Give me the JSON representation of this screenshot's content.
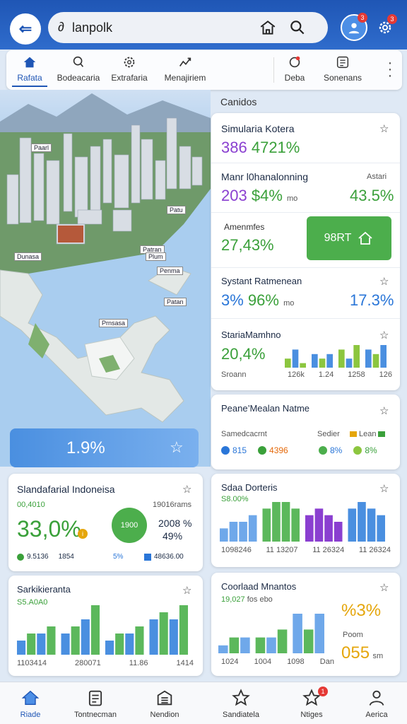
{
  "header": {
    "back_glyph": "⇐",
    "search_lead": "∂",
    "search_value": "lanpolk",
    "badge_1": "3",
    "badge_2": "3"
  },
  "tabs": [
    {
      "label": "Rafata",
      "icon": "home-icon"
    },
    {
      "label": "Bodeacaria",
      "icon": "search-icon"
    },
    {
      "label": "Extrafaria",
      "icon": "gear-icon"
    },
    {
      "label": "Menajiriem",
      "icon": "chart-icon"
    },
    {
      "label": "Deba",
      "icon": "location-icon"
    },
    {
      "label": "Sonenans",
      "icon": "grid-icon"
    }
  ],
  "map": {
    "labels": [
      "Paarl",
      "Patu",
      "Dunasa",
      "Patran",
      "Plum",
      "Penma",
      "Patan",
      "Prnsasa"
    ]
  },
  "candidos_label": "Canidos",
  "cards": {
    "c1": {
      "title": "Simularia Kotera",
      "v1": "386",
      "v2": "4721%"
    },
    "c2": {
      "title": "Manr l0hanalonning",
      "v1": "203",
      "v2": "$4%",
      "v2s": "mo",
      "r_label": "Astari",
      "r_value": "43.5%"
    },
    "c3": {
      "title": "Amenmfes",
      "value": "27,43%",
      "button": "98RT"
    },
    "c4": {
      "title": "Systant Ratmenean",
      "v1": "3%",
      "v2": "96%",
      "v2s": "mo",
      "r_value": "17.3%"
    },
    "c5": {
      "title": "StariaMamhno",
      "value": "20,4%",
      "sub": "Sroann",
      "ticks": [
        "126k",
        "1.24",
        "1258",
        "126"
      ]
    },
    "c6": {
      "title": "Peane’Mealan Natme",
      "sub": "Samedcacrnt",
      "sub_r1": "Sedier",
      "sub_r2": "Lean",
      "m1": "815",
      "m2": "4396",
      "m3": "8%",
      "m4": "8%"
    },
    "promo": {
      "value": "1.9%"
    },
    "c7": {
      "title": "Slandafarial Indoneisa",
      "sub": "00,4010",
      "sub_r": "19016rams",
      "big": "33,0%",
      "r1": "2008 %",
      "r2": "49%",
      "circle": "1900",
      "f1": "9.5136",
      "f2": "1854",
      "f3": "5%",
      "f4": "48636.00"
    },
    "c8": {
      "title": "Sdaa Dorteris",
      "sub": "S8.00%",
      "ticks": [
        "1098246",
        "11 13207",
        "11 26324",
        "11 26324"
      ]
    },
    "c9": {
      "title": "Sarkikieranta",
      "sub": "S5.A0A0",
      "ticks": [
        "1103414",
        "280071",
        "11.86",
        "1414"
      ]
    },
    "c10": {
      "title": "Coorlaad Mnantos",
      "sub": "19,027",
      "sub_b": "fos ebo",
      "r1": "%3%",
      "r_label": "Poom",
      "r2": "055",
      "r2s": "sm",
      "ticks": [
        "1024",
        "1004",
        "1098",
        "Dan"
      ]
    }
  },
  "bottom_nav": [
    {
      "label": "Riade",
      "icon": "home-icon"
    },
    {
      "label": "Tontnecman",
      "icon": "clipboard-icon"
    },
    {
      "label": "Nendion",
      "icon": "newspaper-icon"
    },
    {
      "label": "Sandiatela",
      "icon": "star-icon"
    },
    {
      "label": "Ntiges",
      "icon": "bell-icon",
      "badge": "1"
    },
    {
      "label": "Aerica",
      "icon": "user-icon"
    }
  ],
  "chart_data": [
    {
      "type": "bar",
      "title": "StariaMamhno",
      "series": [
        {
          "values": [
            2,
            4,
            1,
            3,
            2,
            3,
            4,
            2,
            5,
            4,
            3,
            5
          ]
        }
      ]
    },
    {
      "type": "bar",
      "title": "Sdaa Dorteris",
      "series": [
        {
          "values": [
            2,
            3,
            3,
            4,
            5,
            6,
            6,
            5,
            4,
            5,
            4,
            3,
            5,
            6,
            5,
            4
          ]
        }
      ]
    },
    {
      "type": "bar",
      "title": "Sarkikieranta",
      "series": [
        {
          "values": [
            2,
            3,
            3,
            4,
            3,
            4,
            5,
            7,
            2,
            3,
            3,
            4,
            5,
            6,
            5,
            7
          ]
        }
      ]
    },
    {
      "type": "bar",
      "title": "Coorlaad Mnantos",
      "series": [
        {
          "values": [
            1,
            2,
            2,
            2,
            2,
            3,
            5,
            3,
            5
          ]
        }
      ]
    }
  ]
}
